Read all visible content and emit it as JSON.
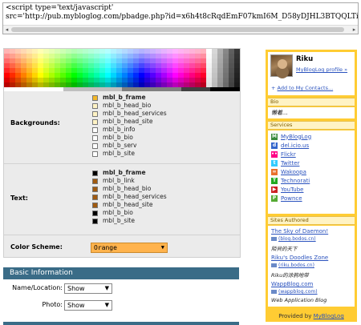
{
  "code_box": {
    "line1": "<script type='text/javascript'",
    "line2": "src='http://pub.mybloglog.com/pbadge.php?id=x6h4t8cRqdEmF07kmI6M_D58yDJHL3BTQQLTiw--'></scri"
  },
  "config": {
    "backgrounds_label": "Backgrounds:",
    "text_label": "Text:",
    "color_scheme_label": "Color Scheme:",
    "color_scheme_value": "Orange",
    "backgrounds": [
      {
        "name": "mbl_b_frame",
        "color": "#f2b72b"
      },
      {
        "name": "mbl_b_head_bio",
        "color": "#fff3c4"
      },
      {
        "name": "mbl_b_head_services",
        "color": "#fff3c4"
      },
      {
        "name": "mbl_b_head_site",
        "color": "#fff3c4"
      },
      {
        "name": "mbl_b_info",
        "color": "#ffffff"
      },
      {
        "name": "mbl_b_bio",
        "color": "#ffffff"
      },
      {
        "name": "mbl_b_serv",
        "color": "#ffffff"
      },
      {
        "name": "mbl_b_site",
        "color": "#ffffff"
      }
    ],
    "texts": [
      {
        "name": "mbl_b_frame",
        "color": "#000000"
      },
      {
        "name": "mbl_b_link",
        "color": "#a05a10"
      },
      {
        "name": "mbl_b_head_bio",
        "color": "#a05a10"
      },
      {
        "name": "mbl_b_head_services",
        "color": "#a05a10"
      },
      {
        "name": "mbl_b_head_site",
        "color": "#a05a10"
      },
      {
        "name": "mbl_b_bio",
        "color": "#000000"
      },
      {
        "name": "mbl_b_site",
        "color": "#000000"
      }
    ]
  },
  "basic_info": {
    "title": "Basic Information",
    "name_label": "Name/Location:",
    "name_value": "Show",
    "photo_label": "Photo:",
    "photo_value": "Show"
  },
  "badge": {
    "username": "Riku",
    "profile_link": "MyBlogLog profile »",
    "add_contacts": "Add to My Contacts...",
    "bio_header": "Bio",
    "bio_text": "懒着...",
    "services_header": "Services",
    "services": [
      {
        "label": "MyBlogLog",
        "icon": "mybloglog-icon",
        "color": "#3a8a3a",
        "glyph": "M"
      },
      {
        "label": "del.icio.us",
        "icon": "delicious-icon",
        "color": "#3366cc",
        "glyph": "d"
      },
      {
        "label": "Flickr",
        "icon": "flickr-icon",
        "color": "#ff0084",
        "glyph": "••"
      },
      {
        "label": "Twitter",
        "icon": "twitter-icon",
        "color": "#33ccff",
        "glyph": "t"
      },
      {
        "label": "Wakoopa",
        "icon": "wakoopa-icon",
        "color": "#e8712c",
        "glyph": "∞"
      },
      {
        "label": "Technorati",
        "icon": "technorati-icon",
        "color": "#22aa22",
        "glyph": "T"
      },
      {
        "label": "YouTube",
        "icon": "youtube-icon",
        "color": "#cc2222",
        "glyph": "▶"
      },
      {
        "label": "Pownce",
        "icon": "pownce-icon",
        "color": "#55aa33",
        "glyph": "P"
      }
    ],
    "sites_header": "Sites Authored",
    "sites": [
      {
        "title": "The Sky of Daemon!",
        "url": "blog.bodos.cn",
        "desc": "陌貝的天下"
      },
      {
        "title": "Riku's Doodles Zone",
        "url": "riku.bodos.cn",
        "desc": "Riku的涂鸦地带"
      },
      {
        "title": "WappBlog.com",
        "url": "wappblog.com",
        "desc": "Web Application Blog"
      }
    ],
    "provided_prefix": "Provided by",
    "provided_link": "MyBlogLog"
  }
}
